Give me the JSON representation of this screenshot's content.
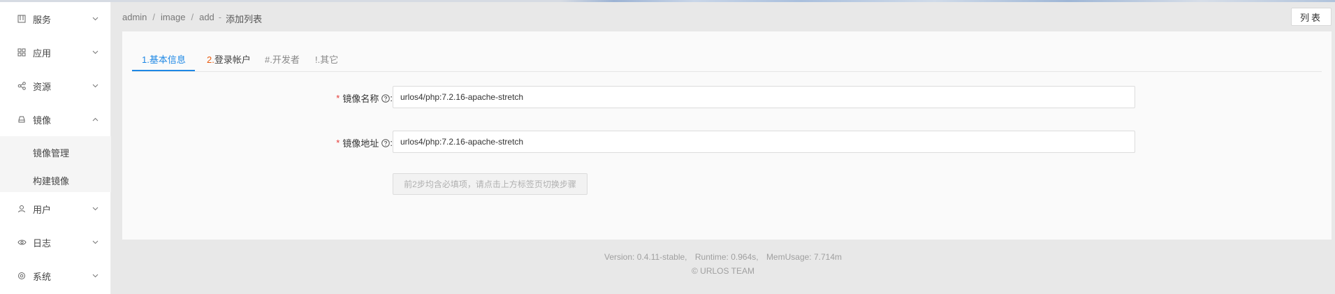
{
  "sidebar": {
    "items": [
      {
        "label": "服务",
        "icon": "services-icon",
        "expanded": false
      },
      {
        "label": "应用",
        "icon": "apps-grid-icon",
        "expanded": false
      },
      {
        "label": "资源",
        "icon": "share-nodes-icon",
        "expanded": false
      },
      {
        "label": "镜像",
        "icon": "drive-icon",
        "expanded": true
      },
      {
        "label": "用户",
        "icon": "user-icon",
        "expanded": false
      },
      {
        "label": "日志",
        "icon": "eye-icon",
        "expanded": false
      },
      {
        "label": "系统",
        "icon": "gear-icon",
        "expanded": false
      }
    ],
    "submenu": [
      {
        "label": "镜像管理"
      },
      {
        "label": "构建镜像"
      }
    ]
  },
  "breadcrumb": {
    "parts": [
      "admin",
      "image",
      "add"
    ],
    "separator": "/",
    "current_prefix": "-",
    "current": "添加列表"
  },
  "header": {
    "list_button": "列表"
  },
  "tabs": {
    "items": [
      {
        "num": "1.",
        "label": "基本信息",
        "state": "active"
      },
      {
        "num": "2.",
        "label": "登录帐户",
        "state": "normal"
      },
      {
        "num": "#.",
        "label": "开发者",
        "state": "muted"
      },
      {
        "num": "!.",
        "label": "其它",
        "state": "muted"
      }
    ]
  },
  "form": {
    "required_mark": "*",
    "fields": [
      {
        "label": "镜像名称",
        "suffix": ":",
        "value": "urlos4/php:7.2.16-apache-stretch"
      },
      {
        "label": "镜像地址",
        "suffix": ":",
        "value": "urlos4/php:7.2.16-apache-stretch"
      }
    ],
    "hint_button": "前2步均含必填项，请点击上方标签页切换步骤"
  },
  "footer": {
    "version": "Version: 0.4.11-stable,",
    "runtime": "Runtime: 0.964s,",
    "memusage": "MemUsage: 7.714m",
    "copyright": "© URLOS TEAM"
  },
  "colors": {
    "accent": "#1e88e5",
    "required": "#e53935",
    "tab_number": "#e8590c",
    "main_bg": "#e8e8e8",
    "card_bg": "#fafafa"
  }
}
